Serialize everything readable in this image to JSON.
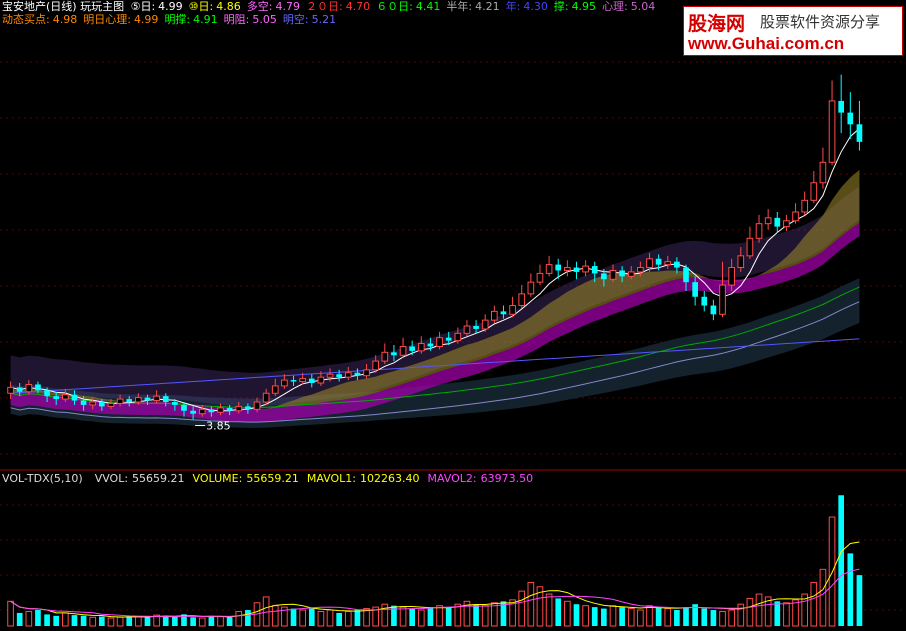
{
  "header": {
    "title": "宝安地产(日线) 玩玩主图",
    "ma": [
      {
        "label": "⑤日:",
        "value": "4.99",
        "color": "#ffffff"
      },
      {
        "label": "⑩日:",
        "value": "4.86",
        "color": "#ffff00"
      },
      {
        "label": "多空:",
        "value": "4.79",
        "color": "#ff66ff"
      },
      {
        "label": "２０日:",
        "value": "4.70",
        "color": "#ff3333"
      },
      {
        "label": "６０日:",
        "value": "4.41",
        "color": "#00ff00"
      },
      {
        "label": "半年:",
        "value": "4.21",
        "color": "#aaaaaa"
      },
      {
        "label": "年:",
        "value": "4.30",
        "color": "#4444ff"
      },
      {
        "label": "撑:",
        "value": "4.95",
        "color": "#00ff00"
      },
      {
        "label": "心理:",
        "value": "5.04",
        "color": "#cc66cc"
      }
    ],
    "line2": [
      {
        "label": "动态买点:",
        "value": "4.98",
        "color": "#ff8800"
      },
      {
        "label": "明日心理:",
        "value": "4.99",
        "color": "#ff8800"
      },
      {
        "label": "明撑:",
        "value": "4.91",
        "color": "#00ff00"
      },
      {
        "label": "明阻:",
        "value": "5.05",
        "color": "#ff66ff"
      },
      {
        "label": "明空:",
        "value": "5.21",
        "color": "#6666ff"
      }
    ]
  },
  "logo": {
    "main": "股海网",
    "sub": "股票软件资源分享",
    "url": "www.Guhai.com.cn"
  },
  "chart_data": {
    "type": "line",
    "low_label": "3.85",
    "price_range": [
      3.6,
      6.2
    ],
    "candles": [
      [
        3.92,
        3.96,
        4.0,
        3.88
      ],
      [
        3.96,
        3.93,
        3.99,
        3.9
      ],
      [
        3.93,
        3.98,
        4.01,
        3.91
      ],
      [
        3.98,
        3.94,
        4.0,
        3.92
      ],
      [
        3.94,
        3.9,
        3.96,
        3.86
      ],
      [
        3.9,
        3.88,
        3.93,
        3.84
      ],
      [
        3.88,
        3.91,
        3.95,
        3.86
      ],
      [
        3.91,
        3.87,
        3.94,
        3.84
      ],
      [
        3.87,
        3.84,
        3.9,
        3.8
      ],
      [
        3.84,
        3.86,
        3.89,
        3.81
      ],
      [
        3.86,
        3.83,
        3.88,
        3.8
      ],
      [
        3.83,
        3.85,
        3.88,
        3.81
      ],
      [
        3.85,
        3.88,
        3.91,
        3.83
      ],
      [
        3.88,
        3.86,
        3.9,
        3.83
      ],
      [
        3.86,
        3.89,
        3.92,
        3.84
      ],
      [
        3.89,
        3.87,
        3.91,
        3.84
      ],
      [
        3.87,
        3.9,
        3.94,
        3.85
      ],
      [
        3.9,
        3.86,
        3.92,
        3.83
      ],
      [
        3.86,
        3.84,
        3.88,
        3.8
      ],
      [
        3.84,
        3.8,
        3.86,
        3.76
      ],
      [
        3.8,
        3.78,
        3.83,
        3.74
      ],
      [
        3.78,
        3.81,
        3.84,
        3.76
      ],
      [
        3.81,
        3.79,
        3.83,
        3.76
      ],
      [
        3.79,
        3.82,
        3.85,
        3.77
      ],
      [
        3.82,
        3.8,
        3.84,
        3.77
      ],
      [
        3.8,
        3.83,
        3.86,
        3.78
      ],
      [
        3.83,
        3.81,
        3.85,
        3.78
      ],
      [
        3.81,
        3.86,
        3.89,
        3.79
      ],
      [
        3.86,
        3.92,
        3.95,
        3.84
      ],
      [
        3.92,
        3.97,
        4.02,
        3.9
      ],
      [
        3.97,
        4.01,
        4.05,
        3.95
      ],
      [
        4.01,
        4.0,
        4.04,
        3.97
      ],
      [
        4.0,
        4.02,
        4.06,
        3.98
      ],
      [
        4.02,
        3.99,
        4.05,
        3.96
      ],
      [
        3.99,
        4.03,
        4.07,
        3.97
      ],
      [
        4.03,
        4.05,
        4.09,
        4.0
      ],
      [
        4.05,
        4.03,
        4.08,
        4.0
      ],
      [
        4.03,
        4.06,
        4.1,
        4.01
      ],
      [
        4.06,
        4.04,
        4.09,
        4.01
      ],
      [
        4.04,
        4.08,
        4.12,
        4.02
      ],
      [
        4.08,
        4.14,
        4.18,
        4.06
      ],
      [
        4.14,
        4.2,
        4.26,
        4.12
      ],
      [
        4.2,
        4.18,
        4.25,
        4.14
      ],
      [
        4.18,
        4.24,
        4.3,
        4.16
      ],
      [
        4.24,
        4.21,
        4.28,
        4.18
      ],
      [
        4.21,
        4.26,
        4.31,
        4.19
      ],
      [
        4.26,
        4.24,
        4.3,
        4.21
      ],
      [
        4.24,
        4.3,
        4.34,
        4.22
      ],
      [
        4.3,
        4.28,
        4.34,
        4.25
      ],
      [
        4.28,
        4.33,
        4.37,
        4.26
      ],
      [
        4.33,
        4.38,
        4.42,
        4.31
      ],
      [
        4.38,
        4.36,
        4.42,
        4.33
      ],
      [
        4.36,
        4.42,
        4.46,
        4.34
      ],
      [
        4.42,
        4.48,
        4.52,
        4.4
      ],
      [
        4.48,
        4.46,
        4.52,
        4.43
      ],
      [
        4.46,
        4.52,
        4.58,
        4.44
      ],
      [
        4.52,
        4.6,
        4.66,
        4.5
      ],
      [
        4.6,
        4.68,
        4.74,
        4.58
      ],
      [
        4.68,
        4.74,
        4.8,
        4.66
      ],
      [
        4.74,
        4.8,
        4.86,
        4.72
      ],
      [
        4.8,
        4.76,
        4.84,
        4.7
      ],
      [
        4.76,
        4.78,
        4.83,
        4.72
      ],
      [
        4.78,
        4.75,
        4.82,
        4.7
      ],
      [
        4.75,
        4.79,
        4.83,
        4.72
      ],
      [
        4.79,
        4.74,
        4.82,
        4.68
      ],
      [
        4.74,
        4.7,
        4.77,
        4.65
      ],
      [
        4.7,
        4.76,
        4.8,
        4.68
      ],
      [
        4.76,
        4.72,
        4.79,
        4.68
      ],
      [
        4.72,
        4.75,
        4.79,
        4.7
      ],
      [
        4.75,
        4.78,
        4.82,
        4.72
      ],
      [
        4.78,
        4.84,
        4.88,
        4.75
      ],
      [
        4.84,
        4.8,
        4.87,
        4.76
      ],
      [
        4.8,
        4.82,
        4.86,
        4.77
      ],
      [
        4.82,
        4.78,
        4.85,
        4.74
      ],
      [
        4.78,
        4.68,
        4.8,
        4.62
      ],
      [
        4.68,
        4.58,
        4.72,
        4.52
      ],
      [
        4.58,
        4.52,
        4.62,
        4.48
      ],
      [
        4.52,
        4.46,
        4.56,
        4.42
      ],
      [
        4.46,
        4.66,
        4.82,
        4.44
      ],
      [
        4.66,
        4.78,
        4.84,
        4.62
      ],
      [
        4.78,
        4.86,
        4.92,
        4.75
      ],
      [
        4.86,
        4.98,
        5.06,
        4.84
      ],
      [
        4.98,
        5.08,
        5.14,
        4.95
      ],
      [
        5.08,
        5.12,
        5.18,
        5.04
      ],
      [
        5.12,
        5.06,
        5.16,
        5.02
      ],
      [
        5.06,
        5.1,
        5.14,
        5.03
      ],
      [
        5.1,
        5.16,
        5.22,
        5.08
      ],
      [
        5.16,
        5.24,
        5.3,
        5.14
      ],
      [
        5.24,
        5.36,
        5.44,
        5.22
      ],
      [
        5.36,
        5.5,
        5.6,
        5.32
      ],
      [
        5.5,
        5.92,
        6.06,
        5.48
      ],
      [
        5.92,
        5.84,
        6.1,
        5.7
      ],
      [
        5.84,
        5.76,
        5.98,
        5.66
      ],
      [
        5.76,
        5.64,
        5.92,
        5.58
      ]
    ],
    "volume": [
      34,
      18,
      20,
      22,
      16,
      14,
      18,
      15,
      14,
      12,
      13,
      11,
      12,
      14,
      13,
      12,
      15,
      14,
      13,
      16,
      12,
      11,
      14,
      13,
      12,
      20,
      22,
      32,
      40,
      28,
      26,
      24,
      22,
      24,
      20,
      22,
      18,
      20,
      22,
      24,
      26,
      30,
      28,
      26,
      24,
      22,
      26,
      28,
      26,
      30,
      34,
      30,
      28,
      32,
      34,
      36,
      48,
      60,
      54,
      44,
      38,
      34,
      30,
      28,
      26,
      24,
      28,
      26,
      24,
      22,
      28,
      26,
      24,
      22,
      26,
      30,
      24,
      22,
      20,
      22,
      30,
      38,
      44,
      40,
      34,
      32,
      36,
      44,
      60,
      78,
      150,
      180,
      100,
      70
    ],
    "volume_range": [
      0,
      190
    ],
    "vol_header": [
      {
        "label": "VOL-TDX(5,10)",
        "value": "",
        "color": "#dddddd"
      },
      {
        "label": "VVOL:",
        "value": "55659.21",
        "color": "#dddddd"
      },
      {
        "label": "VOLUME:",
        "value": "55659.21",
        "color": "#ffff00"
      },
      {
        "label": "MAVOL1:",
        "value": "102263.40",
        "color": "#ffff00"
      },
      {
        "label": "MAVOL2:",
        "value": "63973.50",
        "color": "#ff44ff"
      }
    ],
    "colors": {
      "up": "#ff4a4a",
      "down": "#00ffff",
      "vol_down": "#00ffff",
      "ma5": "#ffffff",
      "mavol1": "#ffff00",
      "mavol2": "#ff44ff",
      "ma60": "#00aa00",
      "year": "#5555ff",
      "half": "#8888cc"
    }
  }
}
